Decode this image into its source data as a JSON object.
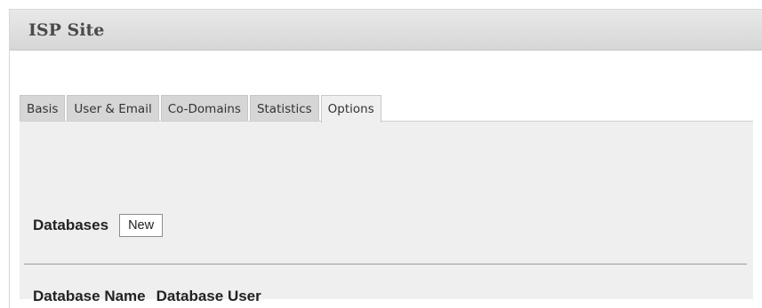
{
  "panel": {
    "title": "ISP Site"
  },
  "tabs": [
    {
      "label": "Basis",
      "active": false
    },
    {
      "label": "User & Email",
      "active": false
    },
    {
      "label": "Co-Domains",
      "active": false
    },
    {
      "label": "Statistics",
      "active": false
    },
    {
      "label": "Options",
      "active": true
    }
  ],
  "databases": {
    "label": "Databases",
    "new_button_label": "New",
    "columns": [
      "Database Name",
      "Database User"
    ]
  },
  "colors": {
    "header_bg": "#dcdcdc",
    "tab_bg": "#d6d6d6",
    "active_tab_bg": "#efefef",
    "content_bg": "#efefef"
  }
}
